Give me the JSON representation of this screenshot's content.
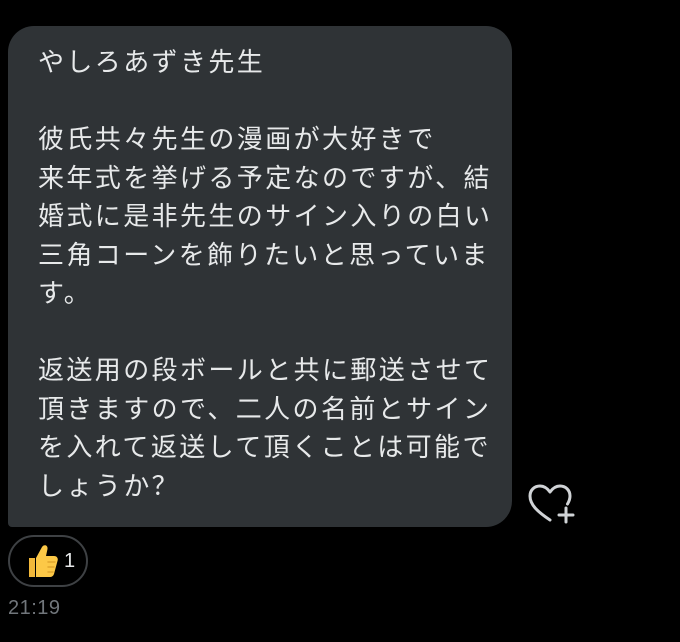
{
  "message": {
    "lines": [
      "やしろあずき先生",
      "",
      "彼氏共々先生の漫画が大好きで",
      "来年式を挙げる予定なのですが、結",
      "婚式に是非先生のサイン入りの白い",
      "三角コーンを飾りたいと思っていま",
      "す。",
      "",
      "返送用の段ボールと共に郵送させて",
      "頂きますので、二人の名前とサイン",
      "を入れて返送して頂くことは可能で",
      "しょうか？"
    ],
    "bubble_color": "#2f3336",
    "text_color": "#e7e9ea"
  },
  "reaction": {
    "icon": "thumbs-up-icon",
    "count": "1"
  },
  "react_button": {
    "icon": "heart-plus-icon"
  },
  "timestamp": "21:19",
  "colors": {
    "background": "#000000",
    "muted_text": "#71767b",
    "border": "#3e4144"
  }
}
